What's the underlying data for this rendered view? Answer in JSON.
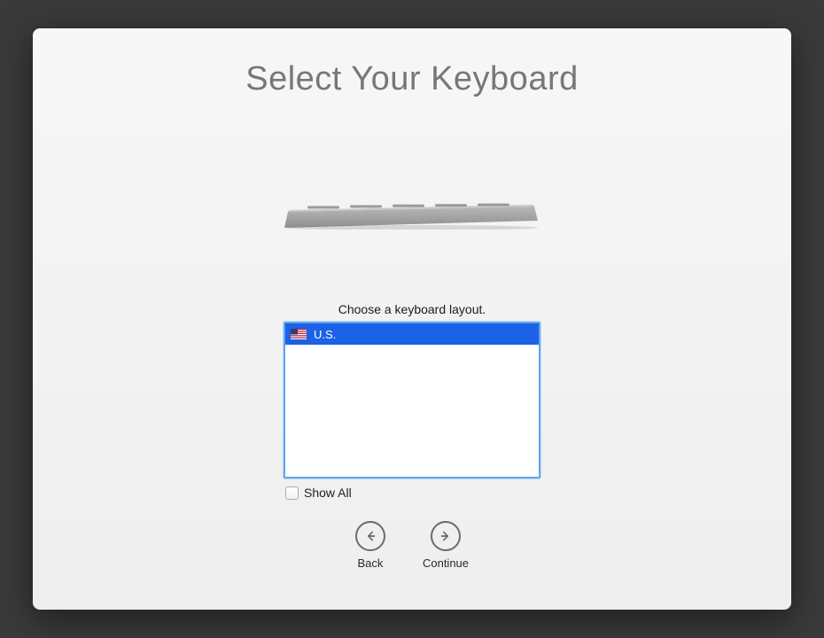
{
  "title": "Select Your Keyboard",
  "prompt": "Choose a keyboard layout.",
  "layouts": [
    {
      "label": "U.S.",
      "flag": "us",
      "selected": true
    }
  ],
  "show_all": {
    "label": "Show All",
    "checked": false
  },
  "nav": {
    "back": "Back",
    "continue": "Continue"
  },
  "colors": {
    "selection": "#1b62e6",
    "focus_border": "#5ea5f2"
  }
}
